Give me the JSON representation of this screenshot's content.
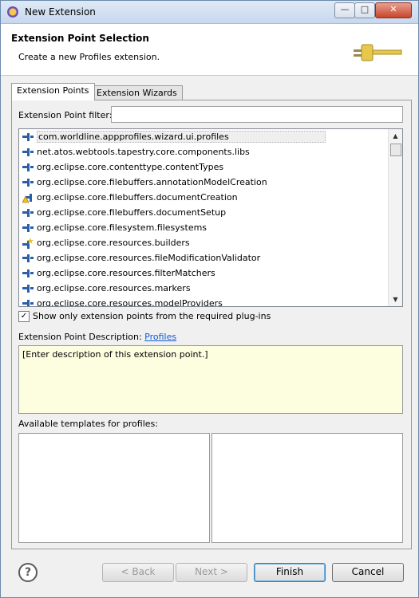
{
  "window": {
    "title": "New Extension"
  },
  "banner": {
    "title": "Extension Point Selection",
    "subtitle": "Create a new Profiles extension."
  },
  "tabs": [
    {
      "label": "Extension Points",
      "active": true
    },
    {
      "label": "Extension Wizards",
      "active": false
    }
  ],
  "filter": {
    "label": "Extension Point filter:",
    "value": ""
  },
  "extension_points": [
    {
      "label": "com.worldline.appprofiles.wizard.ui.profiles",
      "icon": "plug-icon",
      "selected": true
    },
    {
      "label": "net.atos.webtools.tapestry.core.components.libs",
      "icon": "plug-icon"
    },
    {
      "label": "org.eclipse.core.contenttype.contentTypes",
      "icon": "plug-icon"
    },
    {
      "label": "org.eclipse.core.filebuffers.annotationModelCreation",
      "icon": "plug-icon"
    },
    {
      "label": "org.eclipse.core.filebuffers.documentCreation",
      "icon": "warning-plug-icon"
    },
    {
      "label": "org.eclipse.core.filebuffers.documentSetup",
      "icon": "plug-icon"
    },
    {
      "label": "org.eclipse.core.filesystem.filesystems",
      "icon": "plug-icon"
    },
    {
      "label": "org.eclipse.core.resources.builders",
      "icon": "star-plug-icon"
    },
    {
      "label": "org.eclipse.core.resources.fileModificationValidator",
      "icon": "plug-icon"
    },
    {
      "label": "org.eclipse.core.resources.filterMatchers",
      "icon": "plug-icon"
    },
    {
      "label": "org.eclipse.core.resources.markers",
      "icon": "plug-icon"
    },
    {
      "label": "org.eclipse.core.resources.modelProviders",
      "icon": "plug-icon"
    }
  ],
  "only_required": {
    "label": "Show only extension points from the required plug-ins",
    "checked": true
  },
  "description": {
    "label": "Extension Point Description:",
    "link": "Profiles",
    "text": "[Enter description of this extension point.]"
  },
  "templates": {
    "label": "Available templates for profiles:"
  },
  "buttons": {
    "back": "< Back",
    "next": "Next >",
    "finish": "Finish",
    "cancel": "Cancel"
  },
  "help": {
    "glyph": "?"
  },
  "colors": {
    "link": "#0b5bd8",
    "description_bg": "#fdfde0",
    "plug_blue": "#2a5ea8"
  }
}
